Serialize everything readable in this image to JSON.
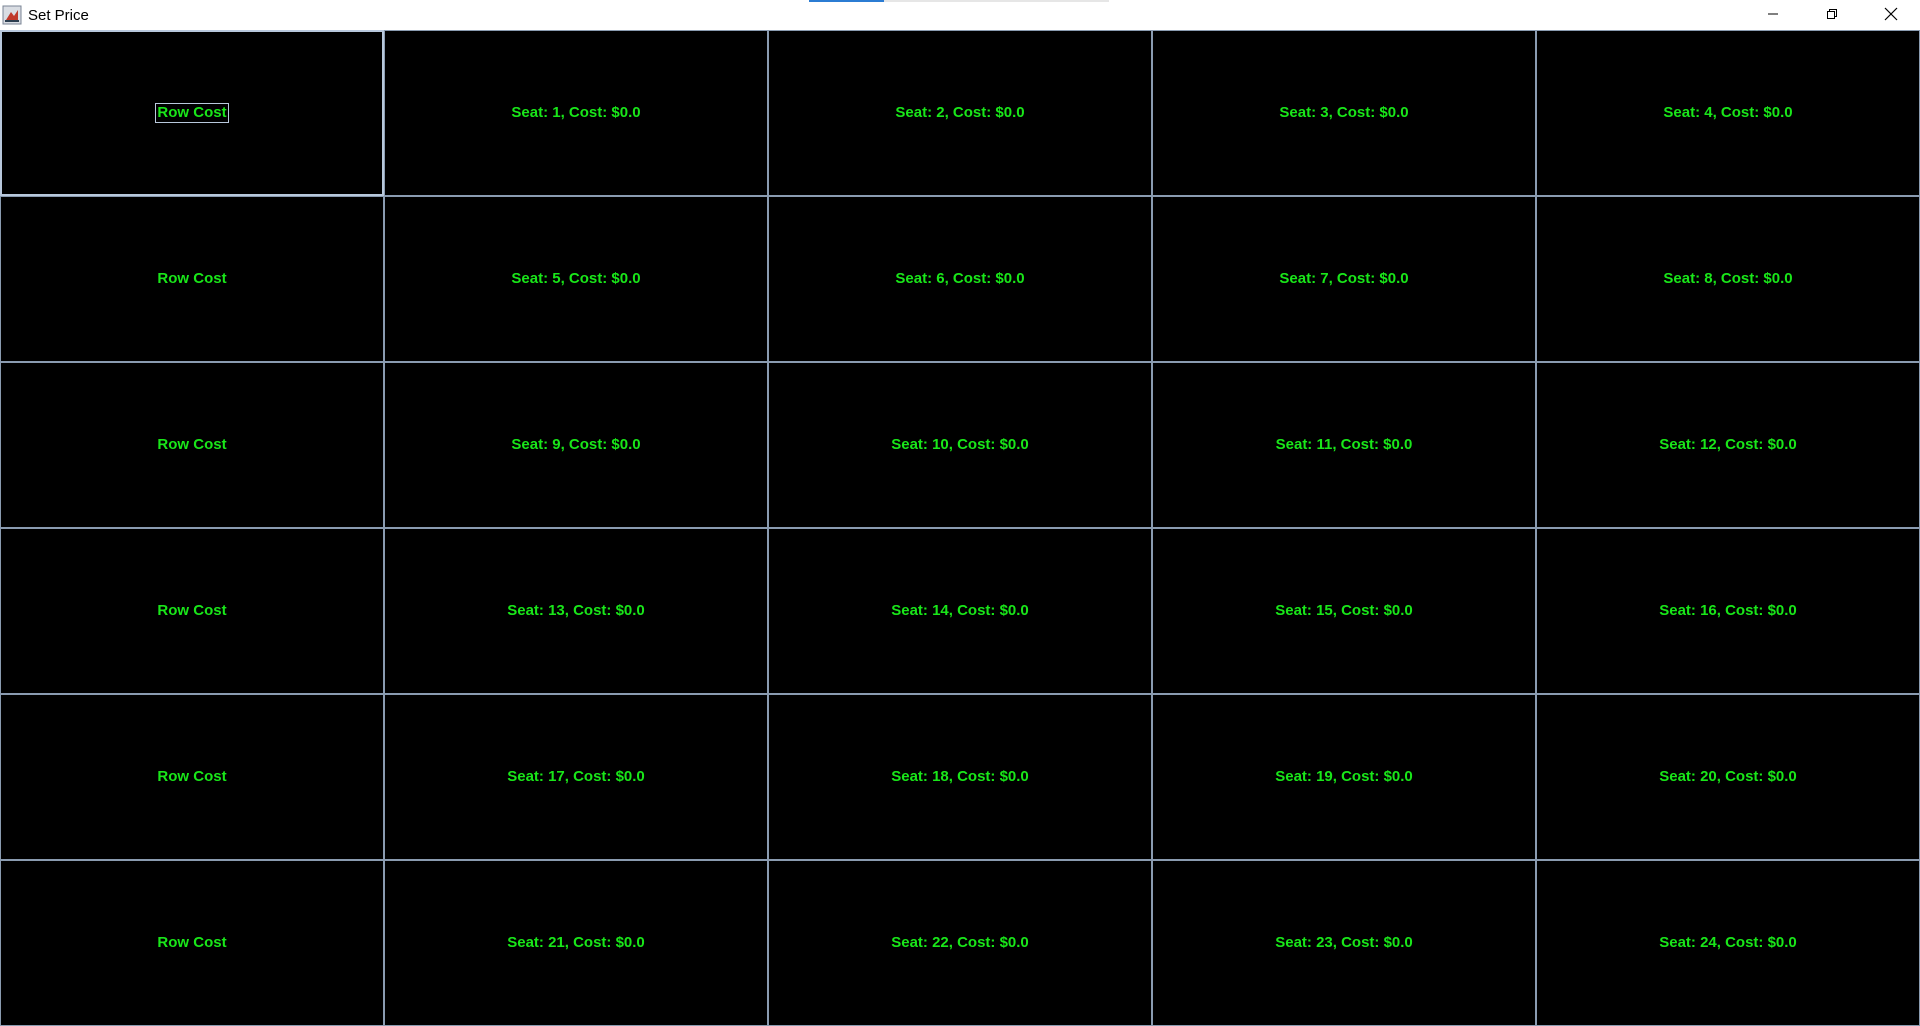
{
  "window": {
    "title": "Set Price",
    "progress": 0.25,
    "icons": {
      "app": "java-app-icon",
      "minimize": "minimize-icon",
      "restore": "restore-icon",
      "close": "close-icon"
    }
  },
  "colors": {
    "background": "#000000",
    "text": "#19e619",
    "border": "#8a9bb0"
  },
  "grid": {
    "rows": [
      {
        "row_label": "Row Cost",
        "seats": [
          "Seat: 1, Cost: $0.0",
          "Seat: 2, Cost: $0.0",
          "Seat: 3, Cost: $0.0",
          "Seat: 4, Cost: $0.0"
        ]
      },
      {
        "row_label": "Row Cost",
        "seats": [
          "Seat: 5, Cost: $0.0",
          "Seat: 6, Cost: $0.0",
          "Seat: 7, Cost: $0.0",
          "Seat: 8, Cost: $0.0"
        ]
      },
      {
        "row_label": "Row Cost",
        "seats": [
          "Seat: 9, Cost: $0.0",
          "Seat: 10, Cost: $0.0",
          "Seat: 11, Cost: $0.0",
          "Seat: 12, Cost: $0.0"
        ]
      },
      {
        "row_label": "Row Cost",
        "seats": [
          "Seat: 13, Cost: $0.0",
          "Seat: 14, Cost: $0.0",
          "Seat: 15, Cost: $0.0",
          "Seat: 16, Cost: $0.0"
        ]
      },
      {
        "row_label": "Row Cost",
        "seats": [
          "Seat: 17, Cost: $0.0",
          "Seat: 18, Cost: $0.0",
          "Seat: 19, Cost: $0.0",
          "Seat: 20, Cost: $0.0"
        ]
      },
      {
        "row_label": "Row Cost",
        "seats": [
          "Seat: 21, Cost: $0.0",
          "Seat: 22, Cost: $0.0",
          "Seat: 23, Cost: $0.0",
          "Seat: 24, Cost: $0.0"
        ]
      }
    ]
  }
}
